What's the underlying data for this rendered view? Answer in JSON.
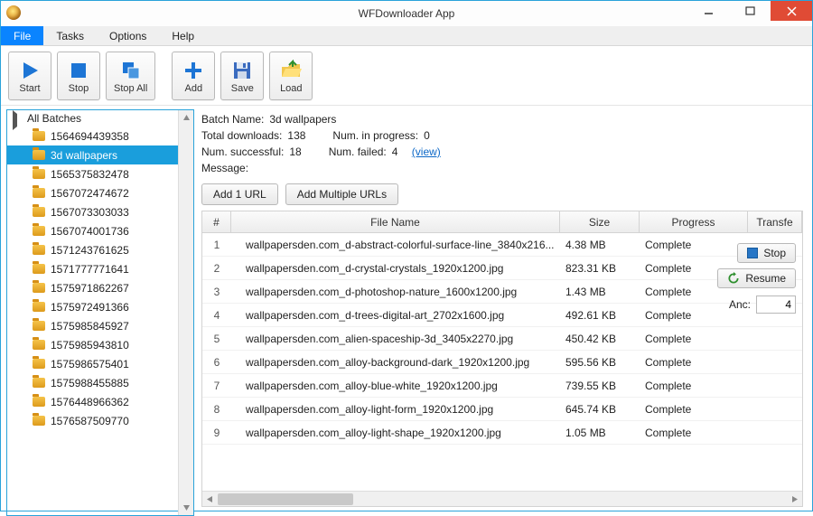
{
  "window": {
    "title": "WFDownloader App"
  },
  "menu": {
    "file": "File",
    "tasks": "Tasks",
    "options": "Options",
    "help": "Help"
  },
  "toolbar": {
    "start": "Start",
    "stop": "Stop",
    "stop_all": "Stop All",
    "add": "Add",
    "save": "Save",
    "load": "Load"
  },
  "sidebar": {
    "root_label": "All Batches",
    "selected_index": 1,
    "items": [
      "1564694439358",
      "3d wallpapers",
      "1565375832478",
      "1567072474672",
      "1567073303033",
      "1567074001736",
      "1571243761625",
      "1571777771641",
      "1575971862267",
      "1575972491366",
      "1575985845927",
      "1575985943810",
      "1575986575401",
      "1575988455885",
      "1576448966362",
      "1576587509770"
    ]
  },
  "batch": {
    "name_label": "Batch Name:",
    "name": "3d wallpapers",
    "total_label": "Total downloads:",
    "total": "138",
    "inprog_label": "Num. in progress:",
    "inprog": "0",
    "succ_label": "Num. successful:",
    "succ": "18",
    "failed_label": "Num. failed:",
    "failed": "4",
    "view": "(view)",
    "message_label": "Message:"
  },
  "actions": {
    "stop": "Stop",
    "resume": "Resume",
    "anc_label": "Anc:",
    "anc_value": "4"
  },
  "url_buttons": {
    "add_one": "Add 1 URL",
    "add_many": "Add Multiple URLs"
  },
  "table": {
    "headers": {
      "idx": "#",
      "fname": "File Name",
      "size": "Size",
      "prog": "Progress",
      "tr": "Transfe"
    },
    "rows": [
      {
        "i": "1",
        "f": "wallpapersden.com_d-abstract-colorful-surface-line_3840x216...",
        "s": "4.38 MB",
        "p": "Complete"
      },
      {
        "i": "2",
        "f": "wallpapersden.com_d-crystal-crystals_1920x1200.jpg",
        "s": "823.31 KB",
        "p": "Complete"
      },
      {
        "i": "3",
        "f": "wallpapersden.com_d-photoshop-nature_1600x1200.jpg",
        "s": "1.43 MB",
        "p": "Complete"
      },
      {
        "i": "4",
        "f": "wallpapersden.com_d-trees-digital-art_2702x1600.jpg",
        "s": "492.61 KB",
        "p": "Complete"
      },
      {
        "i": "5",
        "f": "wallpapersden.com_alien-spaceship-3d_3405x2270.jpg",
        "s": "450.42 KB",
        "p": "Complete"
      },
      {
        "i": "6",
        "f": "wallpapersden.com_alloy-background-dark_1920x1200.jpg",
        "s": "595.56 KB",
        "p": "Complete"
      },
      {
        "i": "7",
        "f": "wallpapersden.com_alloy-blue-white_1920x1200.jpg",
        "s": "739.55 KB",
        "p": "Complete"
      },
      {
        "i": "8",
        "f": "wallpapersden.com_alloy-light-form_1920x1200.jpg",
        "s": "645.74 KB",
        "p": "Complete"
      },
      {
        "i": "9",
        "f": "wallpapersden.com_alloy-light-shape_1920x1200.jpg",
        "s": "1.05 MB",
        "p": "Complete"
      }
    ]
  }
}
